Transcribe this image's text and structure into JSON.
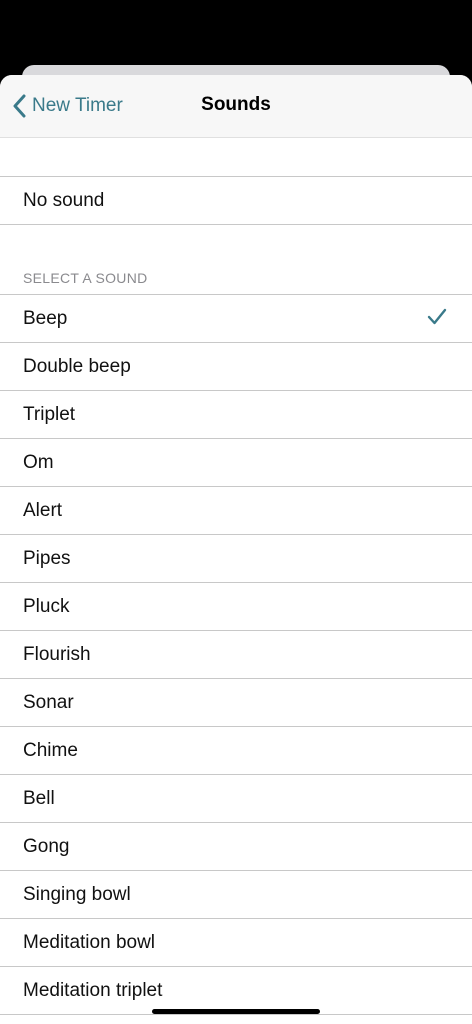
{
  "nav": {
    "back_label": "New Timer",
    "title": "Sounds"
  },
  "none_option": {
    "label": "No sound"
  },
  "section": {
    "header": "SELECT A SOUND"
  },
  "sounds": [
    {
      "label": "Beep",
      "selected": true
    },
    {
      "label": "Double beep",
      "selected": false
    },
    {
      "label": "Triplet",
      "selected": false
    },
    {
      "label": "Om",
      "selected": false
    },
    {
      "label": "Alert",
      "selected": false
    },
    {
      "label": "Pipes",
      "selected": false
    },
    {
      "label": "Pluck",
      "selected": false
    },
    {
      "label": "Flourish",
      "selected": false
    },
    {
      "label": "Sonar",
      "selected": false
    },
    {
      "label": "Chime",
      "selected": false
    },
    {
      "label": "Bell",
      "selected": false
    },
    {
      "label": "Gong",
      "selected": false
    },
    {
      "label": "Singing bowl",
      "selected": false
    },
    {
      "label": "Meditation bowl",
      "selected": false
    },
    {
      "label": "Meditation triplet",
      "selected": false
    }
  ],
  "colors": {
    "accent": "#3a7a8a",
    "separator": "#c8c8c8",
    "section_text": "#8a8a8e"
  }
}
